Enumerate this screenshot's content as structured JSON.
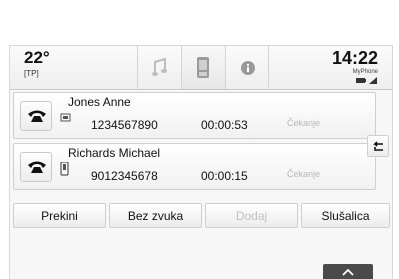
{
  "status": {
    "temperature": "22°",
    "traffic_program": "[TP]",
    "time": "14:22",
    "phone_name": "MyPhone"
  },
  "tabs": [
    {
      "icon": "music-note-icon"
    },
    {
      "icon": "phone-icon",
      "active": true
    },
    {
      "icon": "info-icon"
    }
  ],
  "calls": [
    {
      "name": "Jones Anne",
      "number": "1234567890",
      "duration": "00:00:53",
      "status": "Čekanje",
      "icon": "phone-line-icon"
    },
    {
      "name": "Richards Michael",
      "number": "9012345678",
      "duration": "00:00:15",
      "status": "Čekanje",
      "icon": "mobile-icon"
    }
  ],
  "buttons": {
    "end": "Prekini",
    "mute": "Bez zvuka",
    "add": "Dodaj",
    "handset": "Slušalica"
  },
  "colors": {
    "status_text": "#b8b8b8",
    "bottom_tab": "#4a4a4a"
  }
}
